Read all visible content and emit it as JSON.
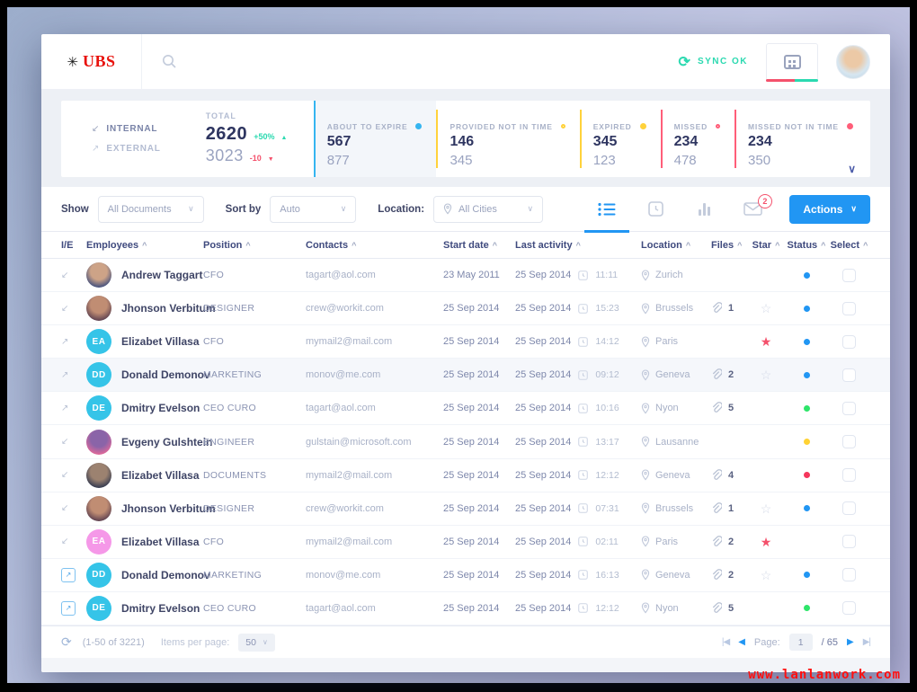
{
  "watermark": "www.lanlanwork.com",
  "header": {
    "logo_text": "UBS",
    "sync_label": "SYNC OK"
  },
  "stats": {
    "internal_label": "INTERNAL",
    "external_label": "EXTERNAL",
    "total": {
      "label": "TOTAL",
      "value1": "2620",
      "delta1": "+50%",
      "value2": "3023",
      "delta2": "-10"
    },
    "cards": [
      {
        "label": "ABOUT TO EXPIRE",
        "value1": "567",
        "value2": "877",
        "color": "#35b5f0",
        "dot": "filled",
        "highlight": true
      },
      {
        "label": "PROVIDED NOT IN TIME",
        "value1": "146",
        "value2": "345",
        "color": "#ffd23b",
        "dot": "hollow",
        "highlight": false
      },
      {
        "label": "EXPIRED",
        "value1": "345",
        "value2": "123",
        "color": "#ffd23b",
        "dot": "filled",
        "highlight": false
      },
      {
        "label": "MISSED",
        "value1": "234",
        "value2": "478",
        "color": "#ff5e79",
        "dot": "hollow",
        "highlight": false
      },
      {
        "label": "MISSED NOT IN TIME",
        "value1": "234",
        "value2": "350",
        "color": "#ff5e79",
        "dot": "filled",
        "highlight": false
      }
    ]
  },
  "toolbar": {
    "show_label": "Show",
    "show_value": "All Documents",
    "sort_label": "Sort by",
    "sort_value": "Auto",
    "location_label": "Location:",
    "location_value": "All Cities",
    "mail_badge": "2",
    "actions_label": "Actions"
  },
  "status_colors": {
    "blue": "#2196f3",
    "green": "#2ee56a",
    "yellow": "#ffd233",
    "red": "#f5365c"
  },
  "star_colors": {
    "filled": "#f4516c",
    "outline": "#d5dbe8"
  },
  "table": {
    "columns": [
      "I/E",
      "Employees",
      "Position",
      "Contacts",
      "Start date",
      "Last activity",
      "Location",
      "Files",
      "Star",
      "Status",
      "Select"
    ],
    "rows": [
      {
        "ie": "internal",
        "avatar": {
          "type": "photo",
          "colors": [
            "#cda387",
            "#43507e"
          ]
        },
        "name": "Andrew Taggart",
        "position": "CFO",
        "contact": "tagart@aol.com",
        "start_date": "23 May 2011",
        "activity_date": "25 Sep 2014",
        "activity_time": "11:11",
        "location": "Zurich",
        "files": "",
        "star": "none",
        "status": "blue",
        "highlight": false
      },
      {
        "ie": "internal",
        "avatar": {
          "type": "photo",
          "colors": [
            "#c08d73",
            "#5e4150"
          ]
        },
        "name": "Jhonson Verbitum",
        "position": "DESIGNER",
        "contact": "crew@workit.com",
        "start_date": "25 Sep 2014",
        "activity_date": "25 Sep 2014",
        "activity_time": "15:23",
        "location": "Brussels",
        "files": "1",
        "star": "outline",
        "status": "blue",
        "highlight": false
      },
      {
        "ie": "external",
        "avatar": {
          "type": "initials",
          "text": "EA",
          "bg": "#35c4e8"
        },
        "name": "Elizabet Villasa",
        "position": "CFO",
        "contact": "mymail2@mail.com",
        "start_date": "25 Sep 2014",
        "activity_date": "25 Sep 2014",
        "activity_time": "14:12",
        "location": "Paris",
        "files": "",
        "star": "filled",
        "status": "blue",
        "highlight": false
      },
      {
        "ie": "external",
        "avatar": {
          "type": "initials",
          "text": "DD",
          "bg": "#35c4e8"
        },
        "name": "Donald Demonov",
        "position": "MARKETING",
        "contact": "monov@me.com",
        "start_date": "25 Sep 2014",
        "activity_date": "25 Sep 2014",
        "activity_time": "09:12",
        "location": "Geneva",
        "files": "2",
        "star": "outline",
        "status": "blue",
        "highlight": true
      },
      {
        "ie": "external",
        "avatar": {
          "type": "initials",
          "text": "DE",
          "bg": "#35c4e8"
        },
        "name": "Dmitry Evelson",
        "position": "CEO CURO",
        "contact": "tagart@aol.com",
        "start_date": "25 Sep 2014",
        "activity_date": "25 Sep 2014",
        "activity_time": "10:16",
        "location": "Nyon",
        "files": "5",
        "star": "none",
        "status": "green",
        "highlight": false
      },
      {
        "ie": "internal",
        "avatar": {
          "type": "photo",
          "colors": [
            "#8a64a8",
            "#e0699a"
          ]
        },
        "name": "Evgeny Gulshtein",
        "position": "ENGINEER",
        "contact": "gulstain@microsoft.com",
        "start_date": "25 Sep 2014",
        "activity_date": "25 Sep 2014",
        "activity_time": "13:17",
        "location": "Lausanne",
        "files": "",
        "star": "none",
        "status": "yellow",
        "highlight": false
      },
      {
        "ie": "internal",
        "avatar": {
          "type": "photo",
          "colors": [
            "#9c8270",
            "#333a50"
          ]
        },
        "name": "Elizabet Villasa",
        "position": "DOCUMENTS",
        "contact": "mymail2@mail.com",
        "start_date": "25 Sep 2014",
        "activity_date": "25 Sep 2014",
        "activity_time": "12:12",
        "location": "Geneva",
        "files": "4",
        "star": "none",
        "status": "red",
        "highlight": false
      },
      {
        "ie": "internal",
        "avatar": {
          "type": "photo",
          "colors": [
            "#c08d73",
            "#5e4150"
          ]
        },
        "name": "Jhonson Verbitum",
        "position": "DESIGNER",
        "contact": "crew@workit.com",
        "start_date": "25 Sep 2014",
        "activity_date": "25 Sep 2014",
        "activity_time": "07:31",
        "location": "Brussels",
        "files": "1",
        "star": "outline",
        "status": "blue",
        "highlight": false
      },
      {
        "ie": "internal",
        "avatar": {
          "type": "initials",
          "text": "EA",
          "bg": "#f598e8"
        },
        "name": "Elizabet Villasa",
        "position": "CFO",
        "contact": "mymail2@mail.com",
        "start_date": "25 Sep 2014",
        "activity_date": "25 Sep 2014",
        "activity_time": "02:11",
        "location": "Paris",
        "files": "2",
        "star": "filled",
        "status": "none",
        "highlight": false
      },
      {
        "ie": "external-link",
        "avatar": {
          "type": "initials",
          "text": "DD",
          "bg": "#35c4e8"
        },
        "name": "Donald Demonov",
        "position": "MARKETING",
        "contact": "monov@me.com",
        "start_date": "25 Sep 2014",
        "activity_date": "25 Sep 2014",
        "activity_time": "16:13",
        "location": "Geneva",
        "files": "2",
        "star": "outline",
        "status": "blue",
        "highlight": false
      },
      {
        "ie": "external-link",
        "avatar": {
          "type": "initials",
          "text": "DE",
          "bg": "#35c4e8"
        },
        "name": "Dmitry Evelson",
        "position": "CEO CURO",
        "contact": "tagart@aol.com",
        "start_date": "25 Sep 2014",
        "activity_date": "25 Sep 2014",
        "activity_time": "12:12",
        "location": "Nyon",
        "files": "5",
        "star": "none",
        "status": "green",
        "highlight": false
      }
    ]
  },
  "footer": {
    "range": "(1-50 of 3221)",
    "items_per_page_label": "Items per page:",
    "items_per_page_value": "50",
    "page_label": "Page:",
    "page_value": "1",
    "page_total": "/ 65"
  }
}
